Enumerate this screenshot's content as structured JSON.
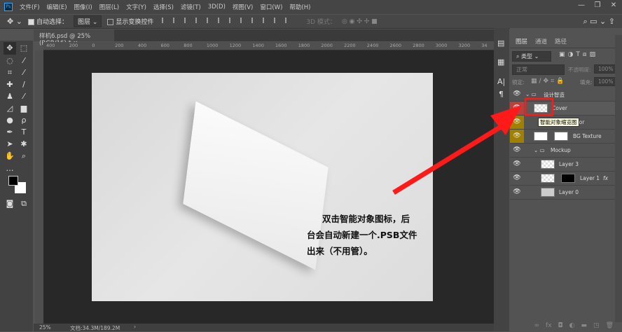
{
  "app": {
    "logo": "Ps"
  },
  "menu": [
    "文件(F)",
    "编辑(E)",
    "图像(I)",
    "图层(L)",
    "文字(Y)",
    "选择(S)",
    "滤镜(T)",
    "3D(D)",
    "视图(V)",
    "窗口(W)",
    "帮助(H)"
  ],
  "window_controls": {
    "minimize": "—",
    "restore": "❐",
    "close": "✕"
  },
  "options": {
    "auto_select_label": "自动选择：",
    "auto_select_checked": true,
    "auto_select_value": "图层",
    "show_transform_label": "显示变换控件",
    "show_transform_checked": false,
    "mode_3d_label": "3D 模式："
  },
  "document_tab": {
    "title": "样机6.psd @ 25%(RGB/16) *",
    "close": "×"
  },
  "ruler_labels": [
    "400",
    "200",
    "0",
    "200",
    "400",
    "600",
    "800",
    "1000",
    "1200",
    "1400",
    "1600",
    "1800",
    "2000",
    "2200",
    "2400",
    "2600",
    "2800",
    "3000",
    "3200",
    "34"
  ],
  "annotation": {
    "line1": "双击智能对象图标，后",
    "line2": "台会自动新建一个.PSB文件",
    "line3": "出来（不用管）。",
    "color": "#ff1a1a"
  },
  "status": {
    "zoom": "25%",
    "doc_info": "文档:34.3M/189.2M",
    "arrow": "›"
  },
  "layers_panel": {
    "tabs": [
      "图层",
      "通道",
      "路径"
    ],
    "filter_label": "类型",
    "blend_mode": "正常",
    "opacity_label": "不透明度:",
    "opacity_value": "100%",
    "lock_label": "锁定:",
    "fill_label": "填充:",
    "fill_value": "100%",
    "tooltip": "智能对象缩览图",
    "layers": [
      {
        "name": "设计智造",
        "type": "group",
        "eye_color": "#535353"
      },
      {
        "name": "Cover",
        "type": "smart",
        "eye_color": "#b8413e"
      },
      {
        "name": "olor",
        "type": "smart",
        "eye_color": "#a08000"
      },
      {
        "name": "BG Texture",
        "type": "smart-mask",
        "eye_color": "#a08000"
      },
      {
        "name": "Mockup",
        "type": "group",
        "eye_color": "#535353"
      },
      {
        "name": "Layer 3",
        "type": "pixel",
        "eye_color": "#535353"
      },
      {
        "name": "Layer 1",
        "type": "smart-mask",
        "fx": "fx",
        "eye_color": "#535353"
      },
      {
        "name": "Layer 0",
        "type": "pixel",
        "eye_color": "#535353"
      }
    ],
    "bottom_icons": [
      "link-icon",
      "fx-icon",
      "mask-icon",
      "adjustment-icon",
      "folder-icon",
      "new-layer-icon",
      "trash-icon"
    ]
  }
}
